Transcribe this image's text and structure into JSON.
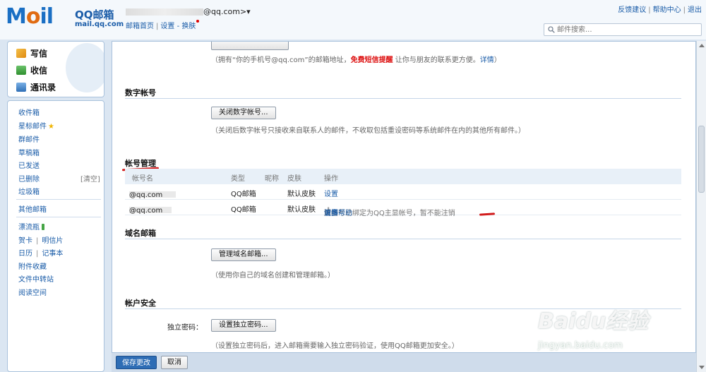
{
  "app": {
    "logo_text": "Mail",
    "brand": "QQ邮箱",
    "domain": "mail.qq.com"
  },
  "header": {
    "user_email_suffix": "@qq.com>▾",
    "links": [
      "邮箱首页",
      "设置",
      "-",
      "换肤"
    ],
    "top_right": [
      "反馈建议",
      "帮助中心",
      "退出"
    ],
    "search_placeholder": "邮件搜索..."
  },
  "sidebar": {
    "main": [
      {
        "label": "写信",
        "icon": "pencil-icon"
      },
      {
        "label": "收信",
        "icon": "inbox-download-icon"
      },
      {
        "label": "通讯录",
        "icon": "contacts-icon"
      }
    ],
    "folders": [
      "收件箱",
      "星标邮件",
      "群邮件",
      "草稿箱",
      "已发送",
      "已删除",
      "垃圾箱"
    ],
    "clear_label": "[清空]",
    "other_folders": "其他邮箱",
    "apps": [
      "漂流瓶",
      "贺卡",
      "明信片",
      "日历",
      "记事本",
      "附件收藏",
      "文件中转站",
      "阅读空间"
    ]
  },
  "main": {
    "top_note": {
      "prefix": "（拥有“你的手机号@qq.com”的邮箱地址，",
      "highlight": "免费短信提醒",
      "middle": " 让你与朋友的联系更方便。",
      "link": "详情",
      "suffix": "）"
    },
    "digital_account": {
      "title": "数字帐号",
      "button": "关闭数字帐号...",
      "note": "（关闭后数字帐号只接收来自联系人的邮件，不收取包括重设密码等系统邮件在内的其他所有邮件。）"
    },
    "account_mgmt": {
      "title": "帐号管理",
      "headers": [
        "帐号名",
        "类型",
        "昵称",
        "皮肤",
        "操作"
      ],
      "rows": [
        {
          "account": "@qq.com",
          "type": "QQ邮箱",
          "nickname": "",
          "skin": "默认皮肤",
          "action": "设置",
          "extra": ""
        },
        {
          "account": "@qq.com",
          "type": "QQ邮箱",
          "nickname": "",
          "skin": "默认皮肤",
          "action": "设置",
          "extra": "该帐号已绑定为QQ主显帐号，暂不能注销",
          "unbind": "解绑",
          "more": "更多帮助"
        }
      ]
    },
    "domain_mail": {
      "title": "域名邮箱",
      "button": "管理域名邮箱...",
      "note": "（使用你自己的域名创建和管理邮箱。）"
    },
    "security": {
      "title": "帐户安全",
      "label": "独立密码：",
      "button": "设置独立密码...",
      "note": "（设置独立密码后，进入邮箱需要输入独立密码验证，使用QQ邮箱更加安全。）"
    }
  },
  "footer": {
    "save": "保存更改",
    "cancel": "取消"
  },
  "watermark": {
    "brand": "Baidu经验",
    "url": "jingyan.baidu.com"
  }
}
